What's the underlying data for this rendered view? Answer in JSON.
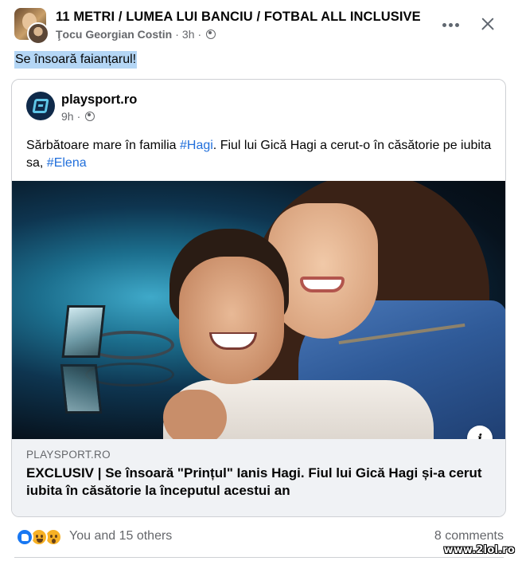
{
  "post": {
    "group_name": "11 METRI / LUMEA LUI BANCIU / FOTBAL ALL INCLUSIVE",
    "author": "Ţocu Georgian Costin",
    "time": "3h",
    "separator": "·",
    "caption": "Se însoară faianțarul!"
  },
  "shared_post": {
    "page_name": "playsport.ro",
    "time": "9h",
    "separator": "·",
    "text_before": "Sărbătoare mare în familia ",
    "hashtag_1": "#Hagi",
    "text_middle": ". Fiul lui Gică Hagi a cerut-o în căsătorie pe iubita sa, ",
    "hashtag_2": "#Elena"
  },
  "link_preview": {
    "domain": "PLAYSPORT.RO",
    "title": "EXCLUSIV | Se însoară \"Prințul\" Ianis Hagi. Fiul lui Gică Hagi și-a cerut iubita în căsătorie la începutul acestui an"
  },
  "footer": {
    "reactions_text": "You and 15 others",
    "comments_text": "8 comments"
  },
  "watermark": "www.2lol.ro",
  "colors": {
    "hashtag": "#216fdb",
    "caption_highlight": "#b4d6f5",
    "like_blue": "#1877f2"
  },
  "icons": [
    "more-options-icon",
    "close-icon",
    "globe-icon",
    "info-icon",
    "like-reaction-icon",
    "haha-reaction-icon",
    "wow-reaction-icon"
  ]
}
